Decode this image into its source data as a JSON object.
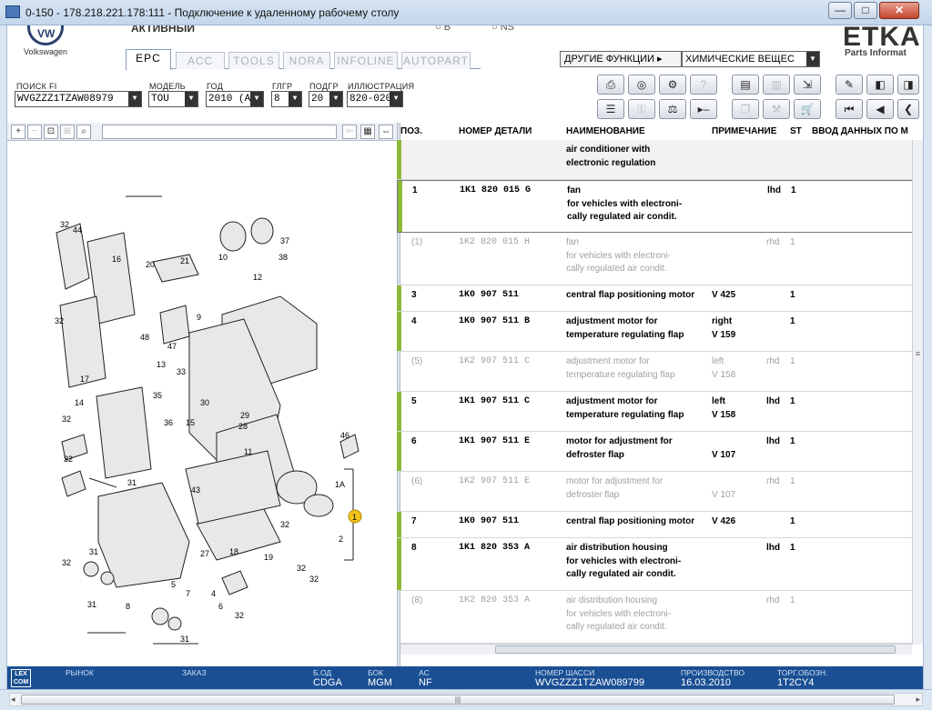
{
  "window": {
    "title": "0-150 - 178.218.221.178:111 - Подключение к удаленному рабочему столу",
    "min": "—",
    "max": "□",
    "close": "✕"
  },
  "header": {
    "brand": "Volkswagen",
    "logo": "VW",
    "active_label": "АКТИВНЫЙ",
    "radio_b": "○ B",
    "radio_ns": "○ NS",
    "etka": "ETKA",
    "etka_sub": "Parts Informat"
  },
  "tabs": [
    "EPC",
    "ACC",
    "TOOLS",
    "NORA",
    "INFOLINE",
    "AUTOPART"
  ],
  "active_tab": "EPC",
  "functions": {
    "label": "ДРУГИЕ ФУНКЦИИ ▸",
    "selected": "ХИМИЧЕСКИЕ ВЕЩЕС"
  },
  "search": {
    "fi_label": "ПОИСК FI",
    "fi_value": "WVGZZZ1TZAW08979",
    "model_label": "МОДЕЛЬ",
    "model_value": "TOU",
    "year_label": "ГОД",
    "year_value": "2010 (A)",
    "mg_label": "ГЛГР",
    "mg_value": "8",
    "sg_label": "ПОДГР",
    "sg_value": "20",
    "ill_label": "ИЛЛЮСТРАЦИЯ",
    "ill_value": "820-020"
  },
  "table": {
    "headers": [
      "ПОЗ.",
      "НОМЕР ДЕТАЛИ",
      "НАИМЕНОВАНИЕ",
      "ПРИМЕЧАНИЕ",
      "ST",
      "ВВОД ДАННЫХ ПО М"
    ],
    "rows": [
      {
        "pos": "",
        "part": "",
        "name": "air conditioner with\nelectronic regulation",
        "note": "",
        "sub": "",
        "st": "",
        "dim": false,
        "shaded": true,
        "sel": false
      },
      {
        "pos": "1",
        "part": "1K1 820 015 G",
        "name": "fan\nfor vehicles with electroni-\ncally regulated air condit.",
        "note": "",
        "sub": "lhd",
        "st": "1",
        "dim": false,
        "shaded": false,
        "sel": true
      },
      {
        "pos": "(1)",
        "part": "1K2 820 015 H",
        "name": "fan\nfor vehicles with electroni-\ncally regulated air condit.",
        "note": "",
        "sub": "rhd",
        "st": "1",
        "dim": true,
        "shaded": false,
        "sel": false
      },
      {
        "pos": "3",
        "part": "1K0 907 511",
        "name": "central flap positioning motor",
        "note": "V 425",
        "sub": "",
        "st": "1",
        "dim": false,
        "shaded": false,
        "sel": false
      },
      {
        "pos": "4",
        "part": "1K0 907 511 B",
        "name": "adjustment motor for\ntemperature regulating flap",
        "note": "right\nV 159",
        "sub": "",
        "st": "1",
        "dim": false,
        "shaded": false,
        "sel": false
      },
      {
        "pos": "(5)",
        "part": "1K2 907 511 C",
        "name": "adjustment motor for\ntemperature regulating flap",
        "note": "left\nV 158",
        "sub": "rhd",
        "st": "1",
        "dim": true,
        "shaded": false,
        "sel": false
      },
      {
        "pos": "5",
        "part": "1K1 907 511 C",
        "name": "adjustment motor for\ntemperature regulating flap",
        "note": "left\nV 158",
        "sub": "lhd",
        "st": "1",
        "dim": false,
        "shaded": false,
        "sel": false
      },
      {
        "pos": "6",
        "part": "1K1 907 511 E",
        "name": "motor for adjustment for\ndefroster flap",
        "note": "\nV 107",
        "sub": "lhd",
        "st": "1",
        "dim": false,
        "shaded": false,
        "sel": false
      },
      {
        "pos": "(6)",
        "part": "1K2 907 511 E",
        "name": "motor for adjustment for\ndefroster flap",
        "note": "\nV 107",
        "sub": "rhd",
        "st": "1",
        "dim": true,
        "shaded": false,
        "sel": false
      },
      {
        "pos": "7",
        "part": "1K0 907 511",
        "name": "central flap positioning motor",
        "note": "V 426",
        "sub": "",
        "st": "1",
        "dim": false,
        "shaded": false,
        "sel": false
      },
      {
        "pos": "8",
        "part": "1K1 820 353 A",
        "name": "air distribution housing\nfor vehicles with electroni-\ncally regulated air condit.",
        "note": "",
        "sub": "lhd",
        "st": "1",
        "dim": false,
        "shaded": false,
        "sel": false
      },
      {
        "pos": "(8)",
        "part": "1K2 820 353 A",
        "name": "air distribution housing\nfor vehicles with electroni-\ncally regulated air condit.",
        "note": "",
        "sub": "rhd",
        "st": "1",
        "dim": true,
        "shaded": false,
        "sel": false
      }
    ]
  },
  "status": {
    "market_label": "РЫНОК",
    "order_label": "ЗАКАЗ",
    "bod_label": "Б.ОД",
    "bod_value": "CDGA",
    "bok_label": "БОК",
    "bok_value": "MGM",
    "ac_label": "AC",
    "ac_value": "NF",
    "vin_label": "НОМЕР ШАССИ",
    "vin_value": "WVGZZZ1TZAW089799",
    "prod_label": "ПРОИЗВОДСТВО",
    "prod_value": "16.03.2010",
    "trade_label": "ТОРГ.ОБОЗН.",
    "trade_value": "1T2CY4",
    "lexcom": "LEX\nCOM"
  },
  "callout": "1"
}
